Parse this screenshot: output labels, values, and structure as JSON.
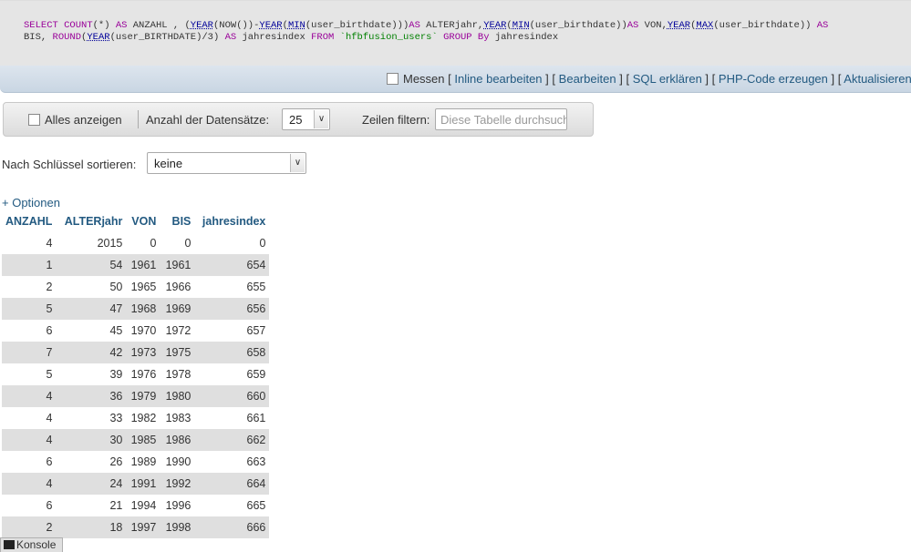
{
  "sql": {
    "line1_parts": [
      {
        "t": "SELECT ",
        "c": "kw"
      },
      {
        "t": "COUNT",
        "c": "kw"
      },
      {
        "t": "(*) ",
        "c": ""
      },
      {
        "t": "AS",
        "c": "kw"
      },
      {
        "t": " ANZAHL , (",
        "c": ""
      },
      {
        "t": "YEAR",
        "c": "fn"
      },
      {
        "t": "(NOW())-",
        "c": ""
      },
      {
        "t": "YEAR",
        "c": "fn"
      },
      {
        "t": "(",
        "c": ""
      },
      {
        "t": "MIN",
        "c": "fn"
      },
      {
        "t": "(user_birthdate)))",
        "c": ""
      },
      {
        "t": "AS",
        "c": "kw"
      },
      {
        "t": " ALTERjahr,",
        "c": ""
      },
      {
        "t": "YEAR",
        "c": "fn"
      },
      {
        "t": "(",
        "c": ""
      },
      {
        "t": "MIN",
        "c": "fn"
      },
      {
        "t": "(user_birthdate))",
        "c": ""
      },
      {
        "t": "AS",
        "c": "kw"
      },
      {
        "t": " VON,",
        "c": ""
      },
      {
        "t": "YEAR",
        "c": "fn"
      },
      {
        "t": "(",
        "c": ""
      },
      {
        "t": "MAX",
        "c": "fn"
      },
      {
        "t": "(user_birthdate)) ",
        "c": ""
      },
      {
        "t": "AS",
        "c": "kw"
      }
    ],
    "line2_parts": [
      {
        "t": "BIS, ",
        "c": ""
      },
      {
        "t": "ROUND",
        "c": "kw"
      },
      {
        "t": "(",
        "c": ""
      },
      {
        "t": "YEAR",
        "c": "fn"
      },
      {
        "t": "(user_BIRTHDATE)/3) ",
        "c": ""
      },
      {
        "t": "AS",
        "c": "kw"
      },
      {
        "t": " jahresindex ",
        "c": ""
      },
      {
        "t": "FROM",
        "c": "kw"
      },
      {
        "t": " ",
        "c": ""
      },
      {
        "t": "`hfbfusion_users`",
        "c": "str"
      },
      {
        "t": " ",
        "c": ""
      },
      {
        "t": "GROUP",
        "c": "kw"
      },
      {
        "t": " ",
        "c": ""
      },
      {
        "t": "By",
        "c": "kw"
      },
      {
        "t": " jahresindex",
        "c": ""
      }
    ]
  },
  "actions": {
    "profiling_label": "Messen",
    "open": "[",
    "close": "]",
    "inline_edit": "Inline bearbeiten",
    "edit": "Bearbeiten",
    "explain": "SQL erklären",
    "php_code": "PHP-Code erzeugen",
    "refresh": "Aktualisieren"
  },
  "navigation": {
    "show_all_label": "Alles anzeigen",
    "row_count_label": "Anzahl der Datensätze:",
    "row_count_value": "25",
    "filter_label": "Zeilen filtern:",
    "filter_placeholder": "Diese Tabelle durchsuchen"
  },
  "sort": {
    "label": "Nach Schlüssel sortieren:",
    "value": "keine"
  },
  "options_link": "+ Optionen",
  "table": {
    "columns": [
      "ANZAHL",
      "ALTERjahr",
      "VON",
      "BIS",
      "jahresindex"
    ],
    "rows": [
      [
        "4",
        "2015",
        "0",
        "0",
        "0"
      ],
      [
        "1",
        "54",
        "1961",
        "1961",
        "654"
      ],
      [
        "2",
        "50",
        "1965",
        "1966",
        "655"
      ],
      [
        "5",
        "47",
        "1968",
        "1969",
        "656"
      ],
      [
        "6",
        "45",
        "1970",
        "1972",
        "657"
      ],
      [
        "7",
        "42",
        "1973",
        "1975",
        "658"
      ],
      [
        "5",
        "39",
        "1976",
        "1978",
        "659"
      ],
      [
        "4",
        "36",
        "1979",
        "1980",
        "660"
      ],
      [
        "4",
        "33",
        "1982",
        "1983",
        "661"
      ],
      [
        "4",
        "30",
        "1985",
        "1986",
        "662"
      ],
      [
        "6",
        "26",
        "1989",
        "1990",
        "663"
      ],
      [
        "4",
        "24",
        "1991",
        "1992",
        "664"
      ],
      [
        "6",
        "21",
        "1994",
        "1996",
        "665"
      ],
      [
        "2",
        "18",
        "1997",
        "1998",
        "666"
      ]
    ]
  },
  "console": {
    "label": "Konsole",
    "icon": "console-icon"
  },
  "colors": {
    "link": "#235a81",
    "row_stripe": "#dfdfdf",
    "keyword": "#990099"
  }
}
